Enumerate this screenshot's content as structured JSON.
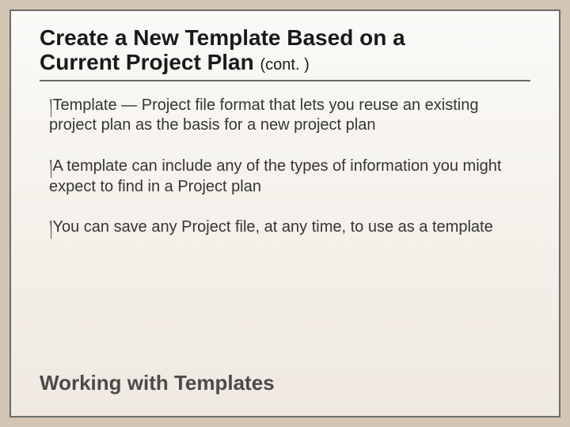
{
  "title": {
    "line1": "Create a New Template Based on a",
    "line2_main": "Current Project Plan ",
    "line2_suffix": "(cont. )"
  },
  "bullet_mark": "།",
  "bullets": [
    {
      "lead": "Template",
      "rest": " — Project file format that lets you reuse an existing project plan as the basis for a new project plan"
    },
    {
      "lead": "A",
      "rest": " template can include any of the types of information you might expect to find in a Project plan"
    },
    {
      "lead": "You",
      "rest": " can save any Project file, at any time, to use as a template"
    }
  ],
  "footer": "Working with Templates"
}
